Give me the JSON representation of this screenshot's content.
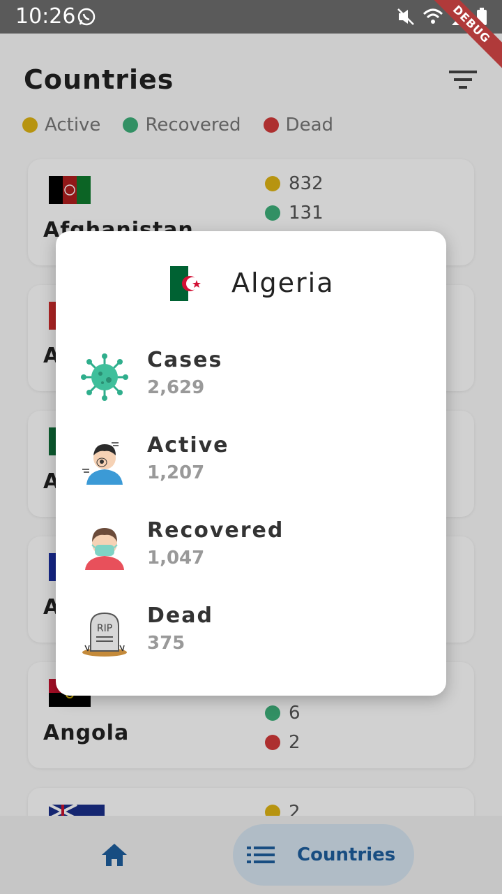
{
  "status_bar": {
    "time": "10:26",
    "debug_label": "DEBUG"
  },
  "header": {
    "title": "Countries"
  },
  "legend": [
    {
      "label": "Active",
      "color": "#e0b514"
    },
    {
      "label": "Recovered",
      "color": "#3db07a"
    },
    {
      "label": "Dead",
      "color": "#d33a3a"
    }
  ],
  "cards": [
    {
      "name": "Afghanistan",
      "stats": [
        "832",
        "131"
      ]
    },
    {
      "name": "A",
      "stats": []
    },
    {
      "name": "A",
      "stats": []
    },
    {
      "name": "A",
      "stats": []
    },
    {
      "name": "Angola",
      "stats": [
        "6",
        "2"
      ]
    },
    {
      "name": "",
      "stats": [
        "2"
      ]
    }
  ],
  "dialog": {
    "country": "Algeria",
    "rows": [
      {
        "label": "Cases",
        "value": "2,629",
        "icon": "virus-icon"
      },
      {
        "label": "Active",
        "value": "1,207",
        "icon": "coughing-person-icon"
      },
      {
        "label": "Recovered",
        "value": "1,047",
        "icon": "masked-person-icon"
      },
      {
        "label": "Dead",
        "value": "375",
        "icon": "tombstone-icon"
      }
    ],
    "tombstone_text": "RIP"
  },
  "nav": {
    "countries_label": "Countries"
  }
}
